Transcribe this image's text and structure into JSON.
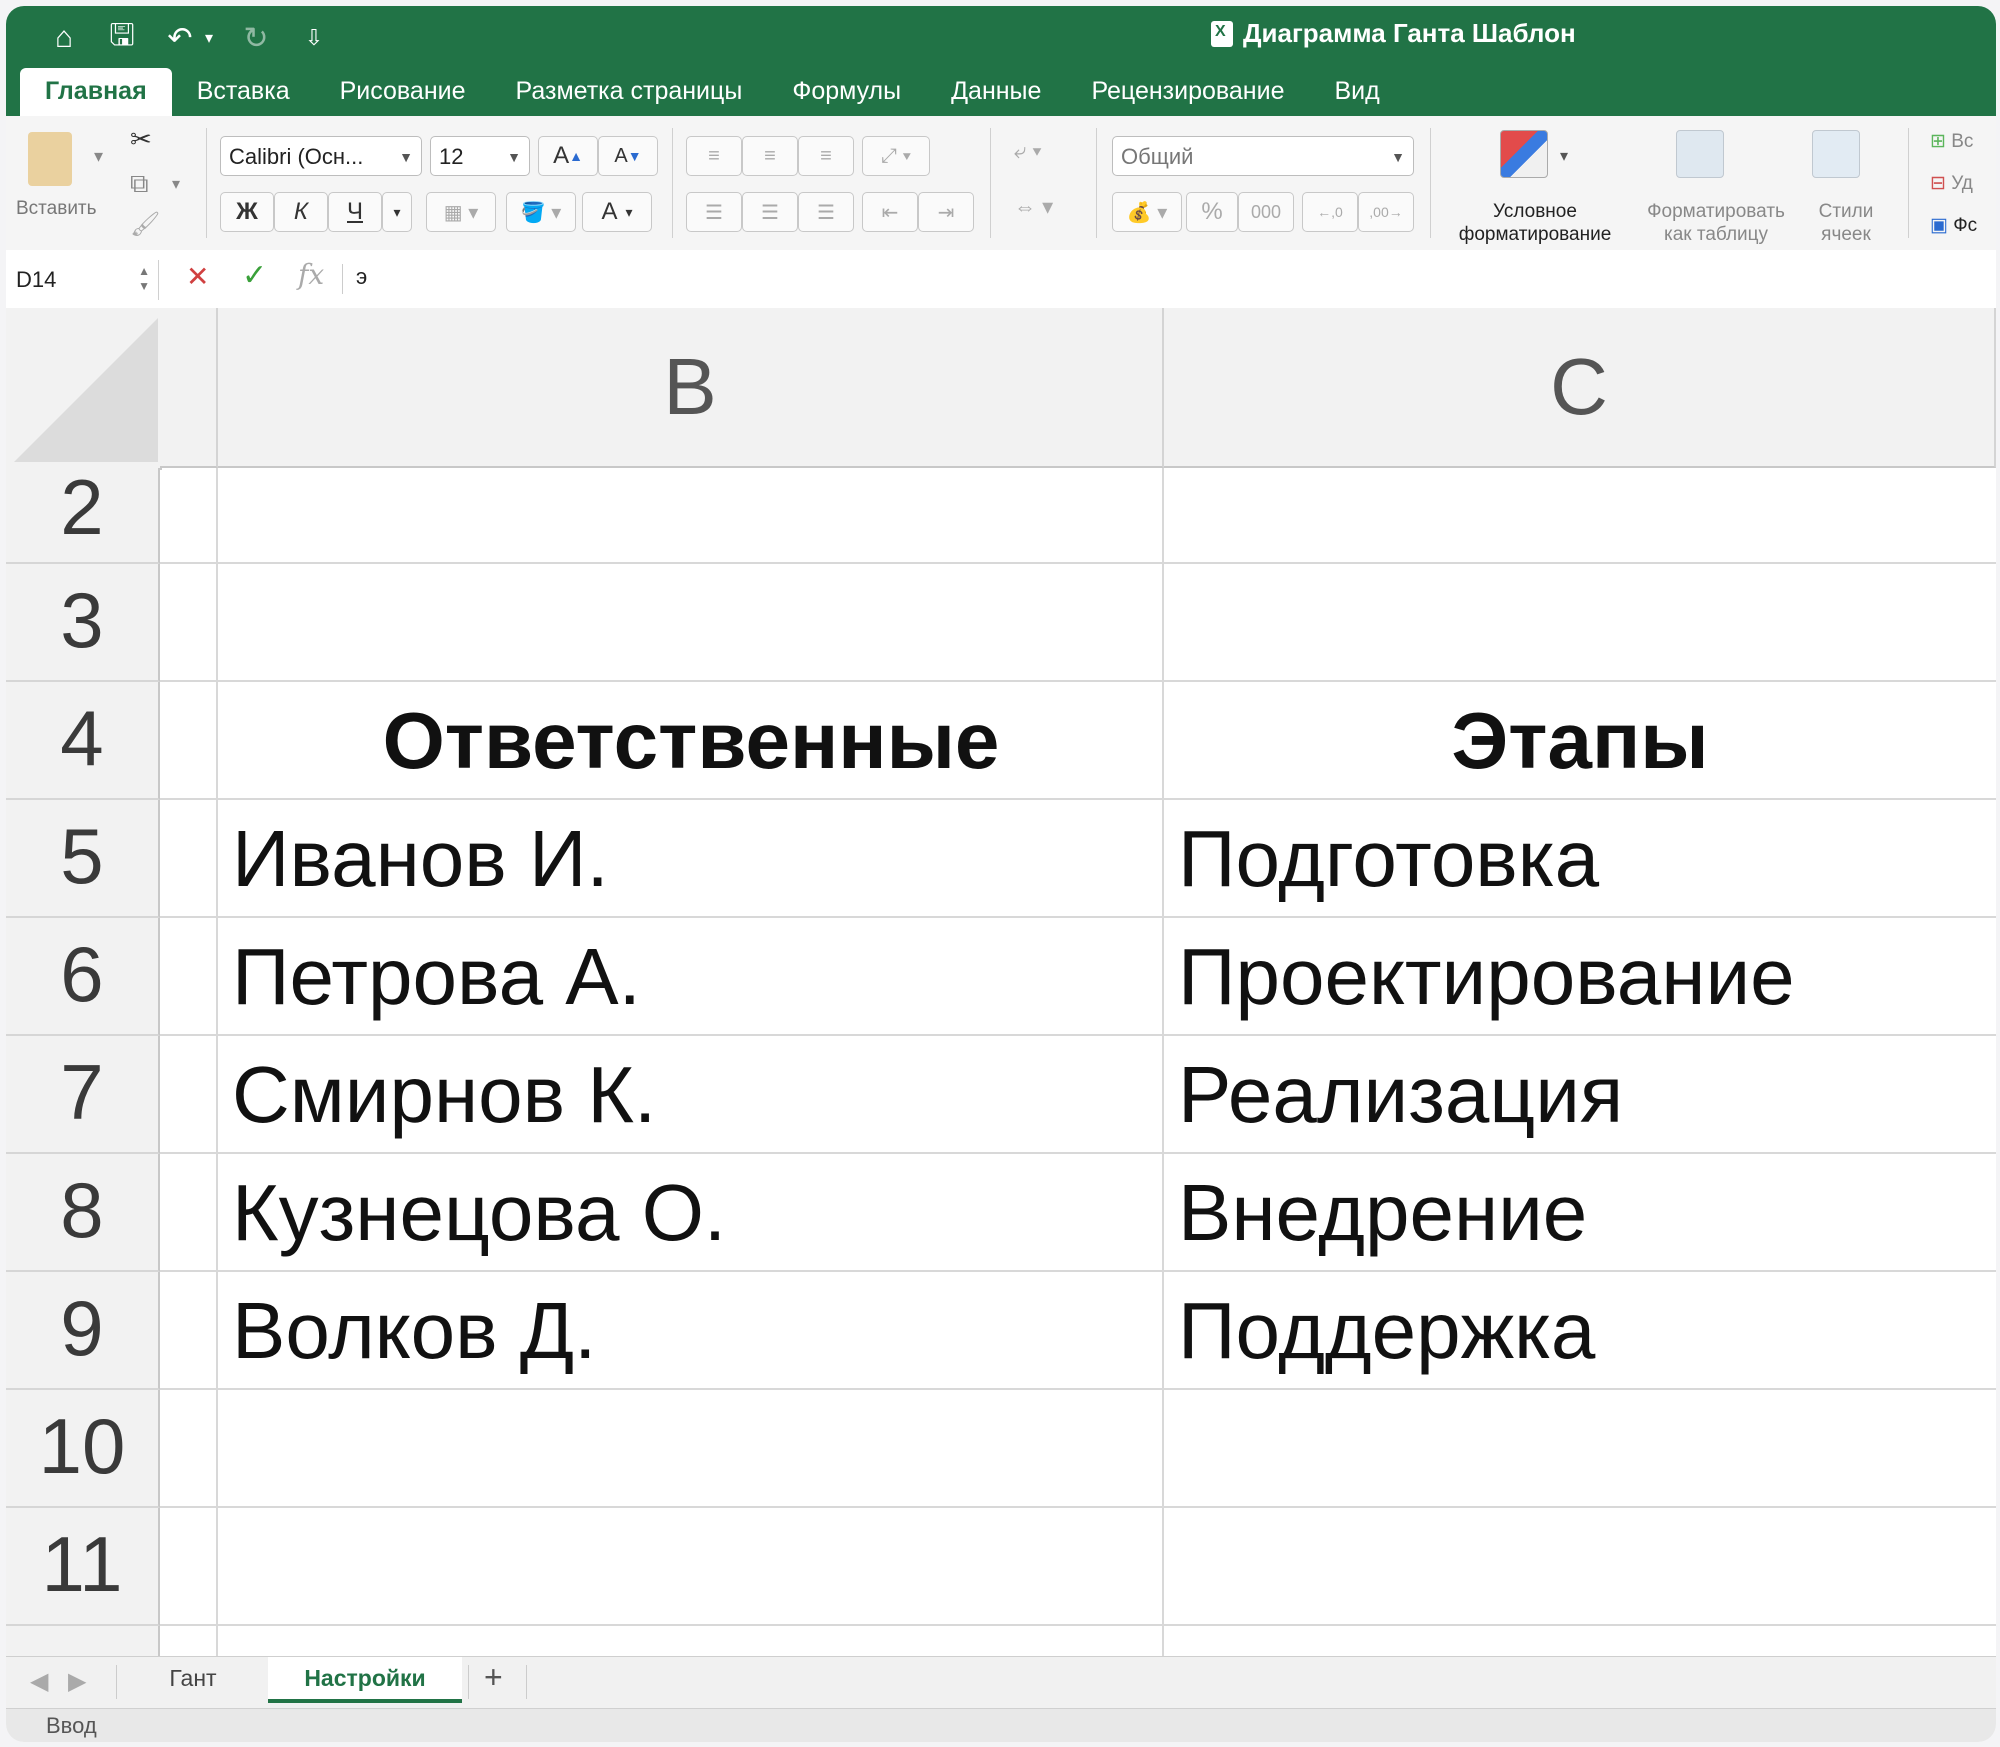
{
  "window": {
    "title": "Диаграмма Ганта Шаблон"
  },
  "qat": {
    "home": "⌂",
    "save": "🖫",
    "undo": "↶",
    "undo_dd": "▾",
    "redo": "↻",
    "customize": "⇩"
  },
  "tabs": [
    {
      "label": "Главная"
    },
    {
      "label": "Вставка"
    },
    {
      "label": "Рисование"
    },
    {
      "label": "Разметка страницы"
    },
    {
      "label": "Формулы"
    },
    {
      "label": "Данные"
    },
    {
      "label": "Рецензирование"
    },
    {
      "label": "Вид"
    }
  ],
  "ribbon": {
    "paste_label": "Вставить",
    "font_name": "Calibri (Осн...",
    "font_size": "12",
    "grow_font": "A",
    "shrink_font": "A",
    "bold": "Ж",
    "italic": "К",
    "underline": "Ч",
    "font_color": "A",
    "number_format": "Общий",
    "percent": "%",
    "thousands": "000",
    "cond_format": "Условное\nформатирование",
    "format_table": "Форматировать\nкак таблицу",
    "cell_styles": "Стили\nячеек",
    "insert_cut": "Вс",
    "delete_cut": "Уд",
    "format_cut": "Фс"
  },
  "formula_bar": {
    "name_box": "D14",
    "cancel": "✕",
    "enter": "✓",
    "fx": "fx",
    "value": "э"
  },
  "columns": [
    "B",
    "C"
  ],
  "rows": [
    {
      "num": "2",
      "b": "",
      "c": ""
    },
    {
      "num": "3",
      "b": "",
      "c": ""
    },
    {
      "num": "4",
      "b": "Ответственные",
      "c": "Этапы"
    },
    {
      "num": "5",
      "b": "Иванов И.",
      "c": "Подготовка"
    },
    {
      "num": "6",
      "b": "Петрова А.",
      "c": "Проектирование"
    },
    {
      "num": "7",
      "b": "Смирнов К.",
      "c": "Реализация"
    },
    {
      "num": "8",
      "b": "Кузнецова О.",
      "c": "Внедрение"
    },
    {
      "num": "9",
      "b": "Волков Д.",
      "c": "Поддержка"
    },
    {
      "num": "10",
      "b": "",
      "c": ""
    },
    {
      "num": "11",
      "b": "",
      "c": ""
    }
  ],
  "sheets": {
    "tab1": "Гант",
    "tab2": "Настройки",
    "add": "+"
  },
  "status": {
    "mode": "Ввод"
  },
  "colors": {
    "accent": "#217346"
  }
}
